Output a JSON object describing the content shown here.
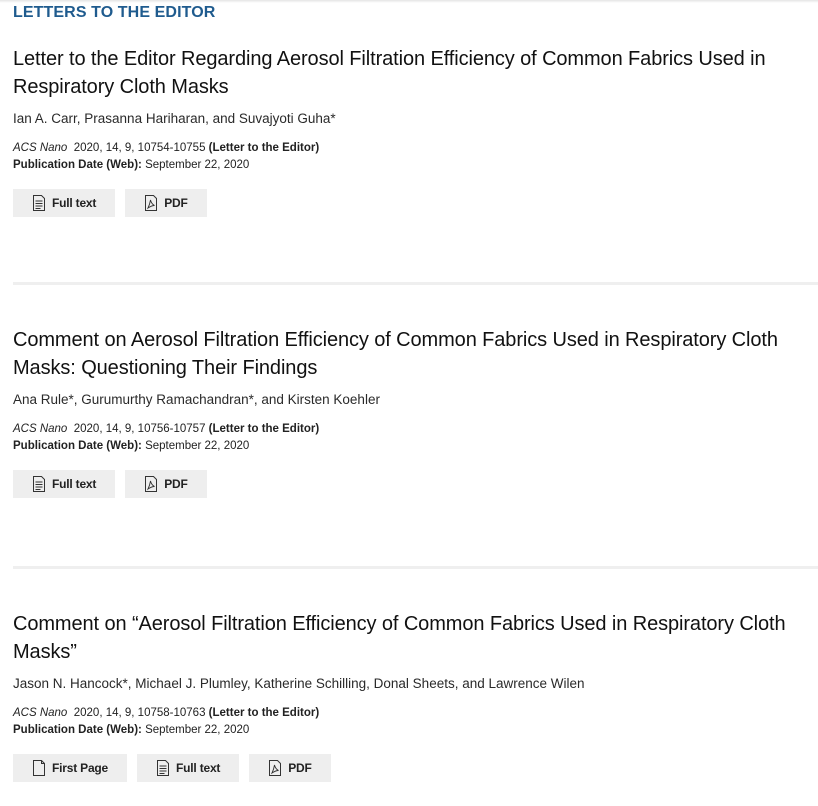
{
  "section": {
    "heading": "LETTERS TO THE EDITOR"
  },
  "articles": [
    {
      "title": "Letter to the Editor Regarding Aerosol Filtration Efficiency of Common Fabrics Used in Respiratory Cloth Masks",
      "authors": "Ian A. Carr, Prasanna Hariharan, and Suvajyoti Guha*",
      "journal": "ACS Nano",
      "citation": "2020, 14, 9, 10754-10755",
      "type_label": "(Letter to the Editor)",
      "pub_date_label": "Publication Date (Web):",
      "pub_date": "September 22, 2020",
      "buttons": [
        "Full text",
        "PDF"
      ]
    },
    {
      "title": "Comment on Aerosol Filtration Efficiency of Common Fabrics Used in Respiratory Cloth Masks: Questioning Their Findings",
      "authors": "Ana Rule*, Gurumurthy Ramachandran*, and Kirsten Koehler",
      "journal": "ACS Nano",
      "citation": "2020, 14, 9, 10756-10757",
      "type_label": "(Letter to the Editor)",
      "pub_date_label": "Publication Date (Web):",
      "pub_date": "September 22, 2020",
      "buttons": [
        "Full text",
        "PDF"
      ]
    },
    {
      "title": "Comment on “Aerosol Filtration Efficiency of Common Fabrics Used in Respiratory Cloth Masks”",
      "authors": "Jason N. Hancock*, Michael J. Plumley, Katherine Schilling, Donal Sheets, and Lawrence Wilen",
      "journal": "ACS Nano",
      "citation": "2020, 14, 9, 10758-10763",
      "type_label": "(Letter to the Editor)",
      "pub_date_label": "Publication Date (Web):",
      "pub_date": "September 22, 2020",
      "buttons": [
        "First Page",
        "Full text",
        "PDF"
      ]
    }
  ],
  "icons": {
    "first_page": "page-icon",
    "full_text": "document-lines-icon",
    "pdf": "pdf-icon"
  },
  "colors": {
    "heading": "#1f5b8e",
    "button_bg": "#eeeeee",
    "divider": "#efefef"
  }
}
